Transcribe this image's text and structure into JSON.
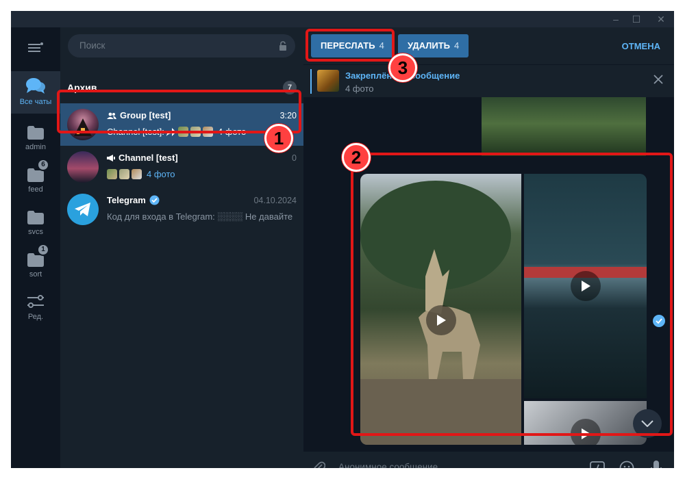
{
  "window": {
    "controls": [
      "–",
      "☐",
      "✕"
    ]
  },
  "rail": {
    "items": [
      {
        "label": "Все чаты",
        "icon": "chats-icon",
        "active": true,
        "badge": ""
      },
      {
        "label": "admin",
        "icon": "folder-icon",
        "badge": ""
      },
      {
        "label": "feed",
        "icon": "folder-icon",
        "badge": "6"
      },
      {
        "label": "svcs",
        "icon": "folder-icon",
        "badge": ""
      },
      {
        "label": "sort",
        "icon": "folder-icon",
        "badge": "1"
      },
      {
        "label": "Ред.",
        "icon": "edit-folders-icon",
        "badge": ""
      }
    ]
  },
  "search": {
    "placeholder": "Поиск"
  },
  "archive": {
    "title": "Архив",
    "count": "7"
  },
  "chats": [
    {
      "name": "Group [test]",
      "time": "3:20",
      "preview_prefix": "Channel [test]:",
      "preview_text": "4 фото",
      "type": "group",
      "selected": true
    },
    {
      "name": "Channel [test]",
      "time": "0",
      "preview_prefix": "",
      "preview_text": "4 фото",
      "type": "channel",
      "selected": false
    },
    {
      "name": "Telegram",
      "time": "04.10.2024",
      "preview_prefix": "",
      "preview_text": "Код для входа в Telegram: ░░░░ Не давайте",
      "type": "verified",
      "selected": false
    }
  ],
  "toolbar": {
    "forward_label": "ПЕРЕСЛАТЬ",
    "forward_count": "4",
    "delete_label": "УДАЛИТЬ",
    "delete_count": "4",
    "cancel_label": "ОТМЕНА"
  },
  "pinned": {
    "title": "Закреплённое сообщение",
    "subtitle": "4 фото"
  },
  "composer": {
    "placeholder": "Анонимное сообщение..."
  },
  "annotations": [
    "1",
    "2",
    "3"
  ],
  "colors": {
    "accent": "#5eb5f7",
    "selected_row": "#2b5278",
    "button": "#2f6ea5",
    "annotation": "#e11717"
  }
}
